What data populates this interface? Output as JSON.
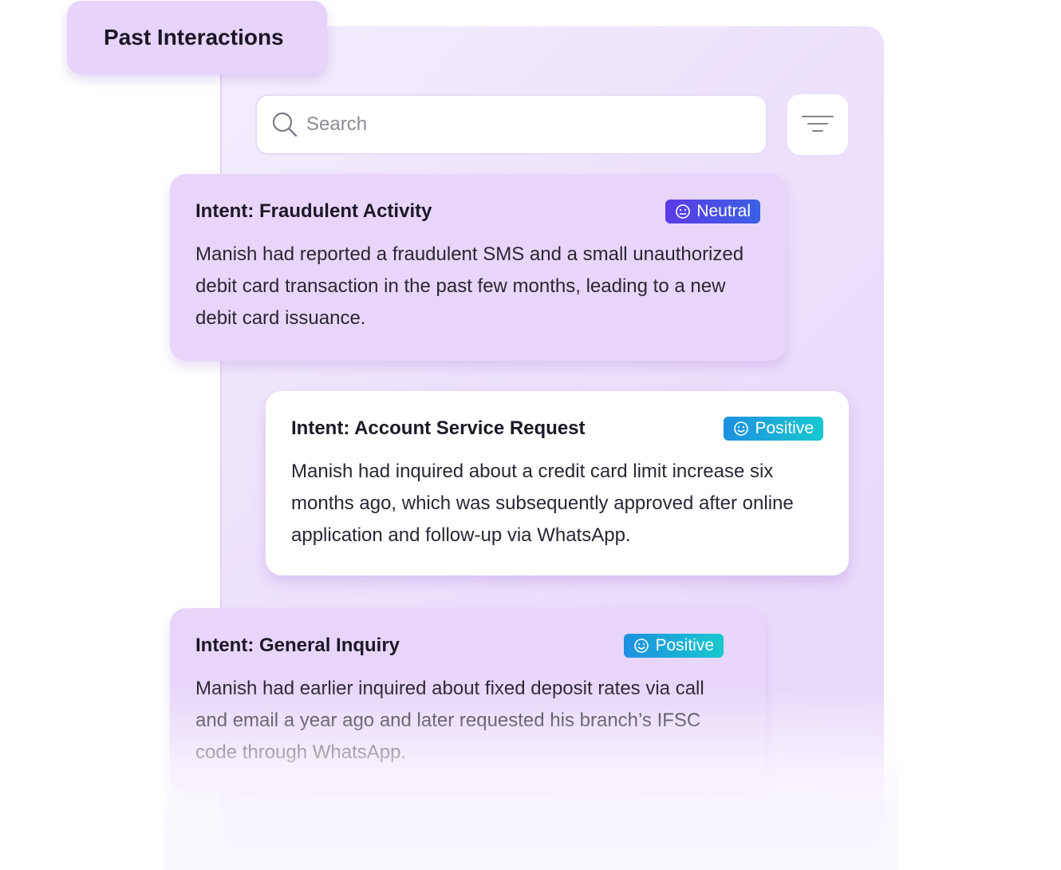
{
  "header": {
    "title": "Past Interactions"
  },
  "search": {
    "placeholder": "Search",
    "value": ""
  },
  "toolbar": {
    "filter_icon": "filter-icon"
  },
  "sentiment_colors": {
    "neutral": "#4a4be6",
    "positive": "#18b0d8"
  },
  "interactions": [
    {
      "intent": "Intent: Fraudulent Activity",
      "sentiment": "Neutral",
      "summary": "Manish had reported a fraudulent SMS and a small unauthorized debit card transaction in the past few months, leading to a new debit card issuance."
    },
    {
      "intent": "Intent: Account Service Request",
      "sentiment": "Positive",
      "summary": "Manish had inquired about a credit card limit increase six months ago, which was subsequently approved after online application and follow-up via WhatsApp."
    },
    {
      "intent": "Intent: General Inquiry",
      "sentiment": "Positive",
      "summary": "Manish had earlier inquired about fixed deposit rates via call and email a year ago and later requested his branch’s IFSC code through WhatsApp."
    }
  ]
}
